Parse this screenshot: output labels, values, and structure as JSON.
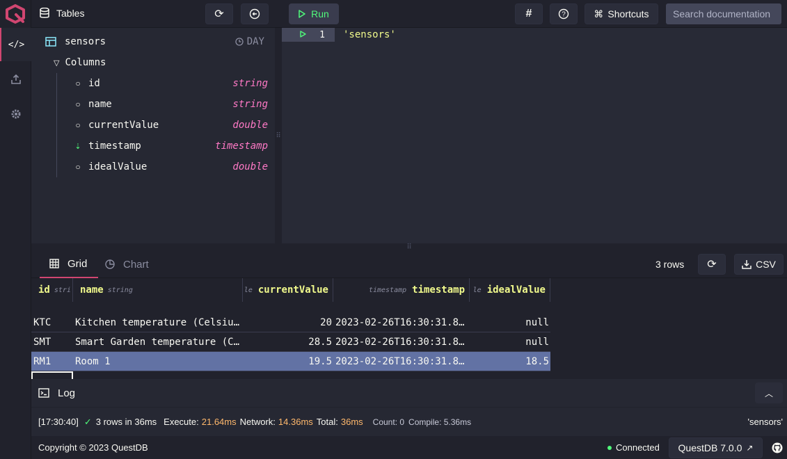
{
  "topbar": {
    "tables_label": "Tables",
    "run_label": "Run",
    "shortcuts_label": "Shortcuts",
    "search_placeholder": "Search documentation"
  },
  "schema": {
    "table_name": "sensors",
    "partition": "DAY",
    "columns_label": "Columns",
    "columns": [
      {
        "name": "id",
        "type": "string"
      },
      {
        "name": "name",
        "type": "string"
      },
      {
        "name": "currentValue",
        "type": "double"
      },
      {
        "name": "timestamp",
        "type": "timestamp"
      },
      {
        "name": "idealValue",
        "type": "double"
      }
    ]
  },
  "editor": {
    "line_number": "1",
    "query": "'sensors'"
  },
  "results": {
    "tab_grid": "Grid",
    "tab_chart": "Chart",
    "row_count": "3 rows",
    "csv_label": "CSV",
    "headers": [
      {
        "name": "id",
        "type": "stri"
      },
      {
        "name": "name",
        "type": "string"
      },
      {
        "name": "currentValue",
        "type": "le"
      },
      {
        "name": "timestamp",
        "type": "timestamp"
      },
      {
        "name": "idealValue",
        "type": "le"
      }
    ],
    "rows": [
      [
        "KTC",
        "Kitchen temperature (Celsiu…",
        "20",
        "2023-02-26T16:30:31.8…",
        "null"
      ],
      [
        "SMT",
        "Smart Garden temperature (C…",
        "28.5",
        "2023-02-26T16:30:31.8…",
        "null"
      ],
      [
        "RM1",
        "Room 1",
        "19.5",
        "2023-02-26T16:30:31.8…",
        "18.5"
      ]
    ]
  },
  "log": {
    "title": "Log",
    "time": "[17:30:40]",
    "summary": "3 rows in 36ms",
    "execute_label": "Execute:",
    "execute_value": "21.64ms",
    "network_label": "Network:",
    "network_value": "14.36ms",
    "total_label": "Total:",
    "total_value": "36ms",
    "count": "Count: 0",
    "compile": "Compile: 5.36ms",
    "query": "'sensors'"
  },
  "footer": {
    "copyright": "Copyright © 2023 QuestDB",
    "status": "Connected",
    "version": "QuestDB 7.0.0"
  },
  "colors": {
    "accent": "#d14671",
    "run_green": "#50fa7b",
    "type_pink": "#ff79c6",
    "header_yellow": "#f1fa8c",
    "timing_orange": "#ffb86c",
    "selected_row": "#6272a4"
  }
}
